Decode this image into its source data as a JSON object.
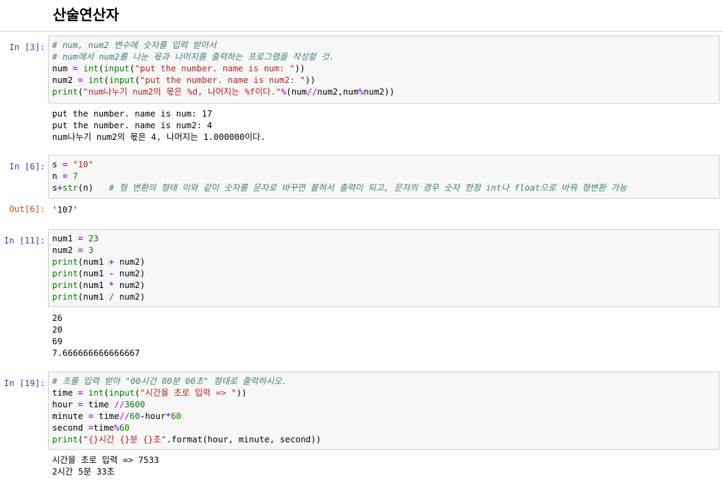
{
  "heading": "산술연산자",
  "cells": [
    {
      "prompt": "In [3]:",
      "code": [
        [
          [
            "c-comment",
            "# num, num2 변수에 숫자를 입력 받아서"
          ]
        ],
        [
          [
            "c-comment",
            "# num에서 num2를 나눈 몫과 나머지를 출력하는 프로그램을 작성할 것."
          ]
        ],
        [
          [
            "",
            "num "
          ],
          [
            "c-op",
            "="
          ],
          [
            "",
            " "
          ],
          [
            "c-kw",
            "int"
          ],
          [
            "",
            "("
          ],
          [
            "c-kw",
            "input"
          ],
          [
            "",
            "("
          ],
          [
            "c-str",
            "\"put the number. name is num: \""
          ],
          [
            "",
            "))"
          ]
        ],
        [
          [
            "",
            "num2 "
          ],
          [
            "c-op",
            "="
          ],
          [
            "",
            " "
          ],
          [
            "c-kw",
            "int"
          ],
          [
            "",
            "("
          ],
          [
            "c-kw",
            "input"
          ],
          [
            "",
            "("
          ],
          [
            "c-str",
            "\"put the number. name is num2: \""
          ],
          [
            "",
            "))"
          ]
        ],
        [
          [
            "c-kw",
            "print"
          ],
          [
            "",
            "("
          ],
          [
            "c-str",
            "\"num나누기 num2의 몫은 %d, 나머지는 %f이다.\""
          ],
          [
            "c-op",
            "%"
          ],
          [
            "",
            "(num"
          ],
          [
            "c-op",
            "//"
          ],
          [
            "",
            "num2,num"
          ],
          [
            "c-op",
            "%"
          ],
          [
            "",
            "num2))"
          ]
        ]
      ],
      "output_prompt": "",
      "output": [
        "put the number. name is num: 17",
        "put the number. name is num2: 4",
        "num나누기 num2의 몫은 4, 나머지는 1.000000이다."
      ]
    },
    {
      "prompt": "In [6]:",
      "code": [
        [
          [
            "",
            "s "
          ],
          [
            "c-op",
            "="
          ],
          [
            "",
            " "
          ],
          [
            "c-str",
            "\"10\""
          ]
        ],
        [
          [
            "",
            "n "
          ],
          [
            "c-op",
            "="
          ],
          [
            "",
            " "
          ],
          [
            "c-num",
            "7"
          ]
        ],
        [
          [
            "",
            "s"
          ],
          [
            "c-op",
            "+"
          ],
          [
            "c-kw",
            "str"
          ],
          [
            "",
            "(n)   "
          ],
          [
            "c-comment",
            "# 형 변환의 형태 이와 같이 숫자를 문자로 바꾸면 붙혀서 출력이 되고, 문자의 경우 숫자 한정 int나 float으로 바꿔 형변환 가능"
          ]
        ]
      ],
      "output_prompt": "Out[6]:",
      "output": [
        "'107'"
      ]
    },
    {
      "prompt": "In [11]:",
      "code": [
        [
          [
            "",
            "num1 "
          ],
          [
            "c-op",
            "="
          ],
          [
            "",
            " "
          ],
          [
            "c-num",
            "23"
          ]
        ],
        [
          [
            "",
            "num2 "
          ],
          [
            "c-op",
            "="
          ],
          [
            "",
            " "
          ],
          [
            "c-num",
            "3"
          ]
        ],
        [
          [
            "c-kw",
            "print"
          ],
          [
            "",
            "(num1 "
          ],
          [
            "c-op",
            "+"
          ],
          [
            "",
            " num2)"
          ]
        ],
        [
          [
            "c-kw",
            "print"
          ],
          [
            "",
            "(num1 "
          ],
          [
            "c-op",
            "-"
          ],
          [
            "",
            " num2)"
          ]
        ],
        [
          [
            "c-kw",
            "print"
          ],
          [
            "",
            "(num1 "
          ],
          [
            "c-op",
            "*"
          ],
          [
            "",
            " num2)"
          ]
        ],
        [
          [
            "c-kw",
            "print"
          ],
          [
            "",
            "(num1 "
          ],
          [
            "c-op",
            "/"
          ],
          [
            "",
            " num2)"
          ]
        ]
      ],
      "output_prompt": "",
      "output": [
        "26",
        "20",
        "69",
        "7.666666666666667"
      ]
    },
    {
      "prompt": "In [19]:",
      "code": [
        [
          [
            "c-comment",
            "# 초를 입력 받아 \"00시간 00분 00초\" 형태로 출력하시오."
          ]
        ],
        [
          [
            "",
            "time "
          ],
          [
            "c-op",
            "="
          ],
          [
            "",
            " "
          ],
          [
            "c-kw",
            "int"
          ],
          [
            "",
            "("
          ],
          [
            "c-kw",
            "input"
          ],
          [
            "",
            "("
          ],
          [
            "c-str",
            "\"시간을 초로 입력 => \""
          ],
          [
            "",
            "))"
          ]
        ],
        [
          [
            "",
            "hour "
          ],
          [
            "c-op",
            "="
          ],
          [
            "",
            " time "
          ],
          [
            "c-op",
            "//"
          ],
          [
            "c-num",
            "3600"
          ]
        ],
        [
          [
            "",
            "minute "
          ],
          [
            "c-op",
            "="
          ],
          [
            "",
            " time"
          ],
          [
            "c-op",
            "//"
          ],
          [
            "c-num",
            "60"
          ],
          [
            "c-op",
            "-"
          ],
          [
            "",
            "hour"
          ],
          [
            "c-op",
            "*"
          ],
          [
            "c-num",
            "60"
          ]
        ],
        [
          [
            "",
            "second "
          ],
          [
            "c-op",
            "="
          ],
          [
            "",
            "time"
          ],
          [
            "c-op",
            "%"
          ],
          [
            "c-num",
            "60"
          ]
        ],
        [
          [
            "c-kw",
            "print"
          ],
          [
            "",
            "("
          ],
          [
            "c-str",
            "\"{}시간 {}분 {}초\""
          ],
          [
            "",
            ".format(hour, minute, second))"
          ]
        ]
      ],
      "output_prompt": "",
      "output": [
        "시간을 초로 입력 => 7533",
        "2시간 5분 33초"
      ]
    }
  ]
}
